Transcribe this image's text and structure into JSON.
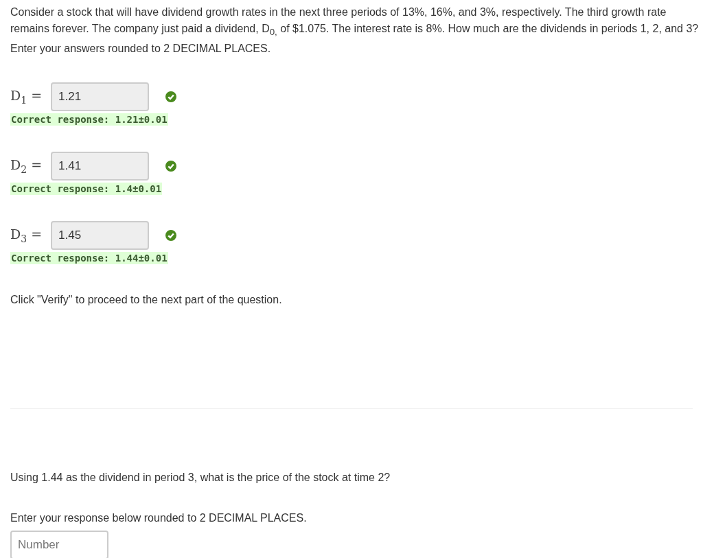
{
  "question": "Consider a stock that will have dividend growth rates in the next three periods of 13%, 16%, and 3%, respectively. The third growth rate remains forever. The company just paid a dividend, D$_{0,}$ of $1.075. The interest rate is 8%. How much are the dividends in periods 1, 2, and 3? Enter your answers rounded to 2 DECIMAL PLACES.",
  "answers": [
    {
      "label": "D$_{1}$ =",
      "value": "1.21",
      "correct": true,
      "feedback": "Correct response: 1.21±0.01"
    },
    {
      "label": "D$_{2}$ =",
      "value": "1.41",
      "correct": true,
      "feedback": "Correct response: 1.4±0.01"
    },
    {
      "label": "D$_{3}$ =",
      "value": "1.45",
      "correct": true,
      "feedback": "Correct response: 1.44±0.01"
    }
  ],
  "instruction": "Click \"Verify\" to proceed to the next part of the question.",
  "next_part": {
    "question": "Using 1.44 as the dividend in period 3, what is the price of the stock at time 2?",
    "prompt": "Enter your response below rounded to 2 DECIMAL PLACES.",
    "input": {
      "placeholder": "Number"
    }
  }
}
